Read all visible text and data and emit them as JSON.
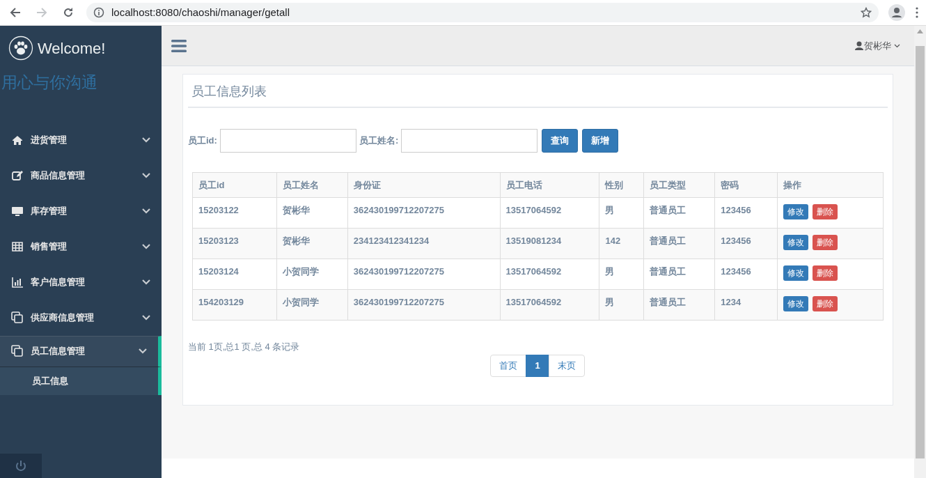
{
  "browser": {
    "url": "localhost:8080/chaoshi/manager/getall",
    "forward_disabled": true
  },
  "sidebar": {
    "brand": "Welcome!",
    "slogan": "用心与你沟通",
    "items": [
      {
        "label": "进货管理",
        "selected": false
      },
      {
        "label": "商品信息管理",
        "selected": false
      },
      {
        "label": "库存管理",
        "selected": false
      },
      {
        "label": "销售管理",
        "selected": false
      },
      {
        "label": "客户信息管理",
        "selected": false
      },
      {
        "label": "供应商信息管理",
        "selected": false
      },
      {
        "label": "员工信息管理",
        "selected": true,
        "children": [
          {
            "label": "员工信息",
            "selected": true
          }
        ]
      }
    ]
  },
  "topbar": {
    "user": "贺彬华"
  },
  "panel": {
    "title": "员工信息列表",
    "search": [
      {
        "label": "员工id:"
      },
      {
        "label": "员工姓名:"
      }
    ],
    "buttons": [
      {
        "label": "查询"
      },
      {
        "label": "新增"
      }
    ],
    "table": {
      "columns": [
        "员工id",
        "员工姓名",
        "身份证",
        "员工电话",
        "性别",
        "员工类型",
        "密码",
        "操作"
      ],
      "rows": [
        {
          "cells": [
            "15203122",
            "贺彬华",
            "362430199712207275",
            "13517064592",
            "男",
            "普通员工",
            "123456"
          ],
          "actions": [
            "修改",
            "删除"
          ]
        },
        {
          "cells": [
            "15203123",
            "贺彬华",
            "234123412341234",
            "13519081234",
            "142",
            "普通员工",
            "123456"
          ],
          "actions": [
            "修改",
            "删除"
          ]
        },
        {
          "cells": [
            "15203124",
            "小贺同学",
            "362430199712207275",
            "13517064592",
            "男",
            "普通员工",
            "123456"
          ],
          "actions": [
            "修改",
            "删除"
          ]
        },
        {
          "cells": [
            "154203129",
            "小贺同学",
            "362430199712207275",
            "13517064592",
            "男",
            "普通员工",
            "1234"
          ],
          "actions": [
            "修改",
            "删除"
          ]
        }
      ]
    },
    "summary": "当前 1页,总1 页,总 4 条记录",
    "pagination": [
      {
        "label": "首页",
        "selected": false
      },
      {
        "label": "1",
        "selected": true
      },
      {
        "label": "末页",
        "selected": false
      }
    ]
  }
}
